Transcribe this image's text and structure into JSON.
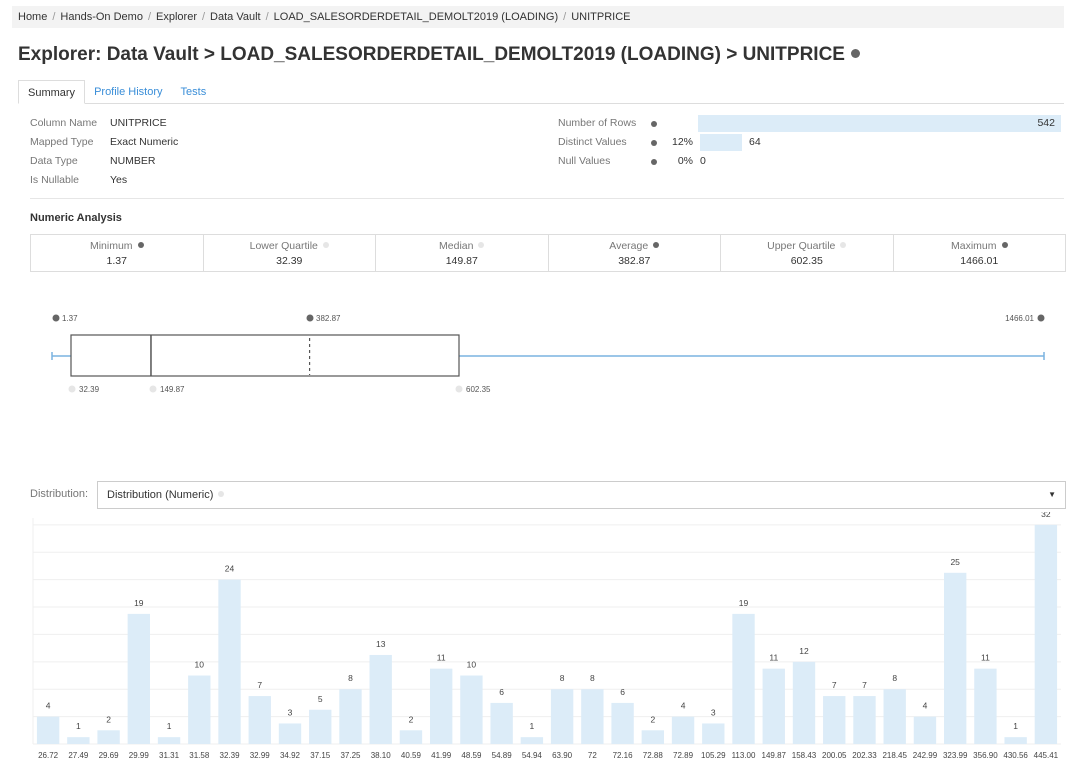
{
  "breadcrumb": [
    "Home",
    "Hands-On Demo",
    "Explorer",
    "Data Vault",
    "LOAD_SALESORDERDETAIL_DEMOLT2019 (LOADING)",
    "UNITPRICE"
  ],
  "page": {
    "title": "Explorer: Data Vault > LOAD_SALESORDERDETAIL_DEMOLT2019 (LOADING) > UNITPRICE"
  },
  "tabs": [
    "Summary",
    "Profile History",
    "Tests"
  ],
  "column_info": [
    {
      "key": "Column Name",
      "value": "UNITPRICE"
    },
    {
      "key": "Mapped Type",
      "value": "Exact Numeric"
    },
    {
      "key": "Data Type",
      "value": "NUMBER"
    },
    {
      "key": "Is Nullable",
      "value": "Yes"
    }
  ],
  "stats": {
    "rows": {
      "label": "Number of Rows",
      "value": "542",
      "pct": "",
      "fill": 1.0
    },
    "distinct": {
      "label": "Distinct Values",
      "value": "64",
      "pct": "12%",
      "fill": 0.118
    },
    "nulls": {
      "label": "Null Values",
      "value": "0",
      "pct": "0%",
      "fill": 0.0
    }
  },
  "numeric_analysis": {
    "title": "Numeric Analysis",
    "items": [
      {
        "label": "Minimum",
        "value": "1.37",
        "dot": "#666666"
      },
      {
        "label": "Lower Quartile",
        "value": "32.39",
        "dot": "#e6e6e6"
      },
      {
        "label": "Median",
        "value": "149.87",
        "dot": "#e6e6e6"
      },
      {
        "label": "Average",
        "value": "382.87",
        "dot": "#666666"
      },
      {
        "label": "Upper Quartile",
        "value": "602.35",
        "dot": "#e6e6e6"
      },
      {
        "label": "Maximum",
        "value": "1466.01",
        "dot": "#666666"
      }
    ]
  },
  "boxplot": {
    "min": 1.37,
    "q1": 32.39,
    "median": 149.87,
    "mean": 382.87,
    "q3": 602.35,
    "max": 1466.01,
    "labels": {
      "min": "1.37",
      "q1": "32.39",
      "median": "149.87",
      "mean": "382.87",
      "q3": "602.35",
      "max": "1466.01"
    }
  },
  "distribution": {
    "label": "Distribution:",
    "selected": "Distribution (Numeric)"
  },
  "chart_data": {
    "type": "bar",
    "categories": [
      "26.72",
      "27.49",
      "29.69",
      "29.99",
      "31.31",
      "31.58",
      "32.39",
      "32.99",
      "34.92",
      "37.15",
      "37.25",
      "38.10",
      "40.59",
      "41.99",
      "48.59",
      "54.89",
      "54.94",
      "63.90",
      "72",
      "72.16",
      "72.88",
      "72.89",
      "105.29",
      "113.00",
      "149.87",
      "158.43",
      "200.05",
      "202.33",
      "218.45",
      "242.99",
      "323.99",
      "356.90",
      "430.56",
      "445.41"
    ],
    "values": [
      4,
      1,
      2,
      19,
      1,
      10,
      24,
      7,
      3,
      5,
      8,
      13,
      2,
      11,
      10,
      6,
      1,
      8,
      8,
      6,
      2,
      4,
      3,
      19,
      11,
      12,
      7,
      7,
      8,
      4,
      25,
      11,
      1,
      32
    ],
    "ylim": [
      0,
      33
    ],
    "grid": true
  },
  "colors": {
    "accent": "#3a8ed8",
    "bar": "#dcecf8",
    "box_line": "#7ab3e0"
  }
}
